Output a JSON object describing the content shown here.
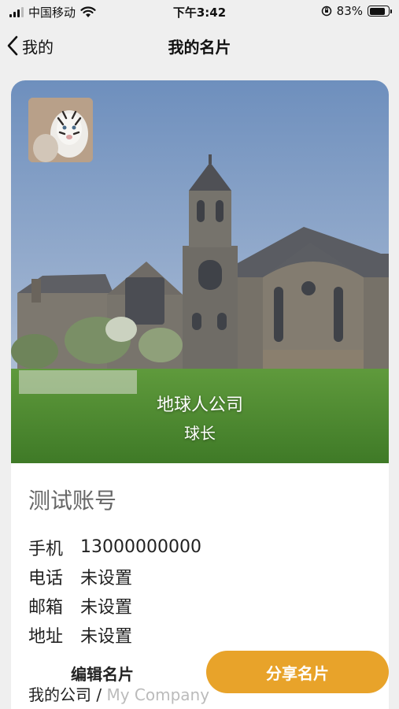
{
  "status_bar": {
    "carrier": "中国移动",
    "time": "下午3:42",
    "battery_text": "83%",
    "battery_level": 0.83
  },
  "nav": {
    "back_label": "我的",
    "title": "我的名片"
  },
  "card": {
    "company": "地球人公司",
    "job_title": "球长",
    "name": "测试账号",
    "fields": [
      {
        "label": "手机",
        "value": "13000000000"
      },
      {
        "label": "电话",
        "value": "未设置"
      },
      {
        "label": "邮箱",
        "value": "未设置"
      },
      {
        "label": "地址",
        "value": "未设置"
      }
    ],
    "company_row": {
      "label": "我的公司 /",
      "placeholder": "My Company"
    }
  },
  "actions": {
    "edit_label": "编辑名片",
    "share_label": "分享名片"
  },
  "colors": {
    "accent": "#e8a32a",
    "background": "#efefef"
  }
}
